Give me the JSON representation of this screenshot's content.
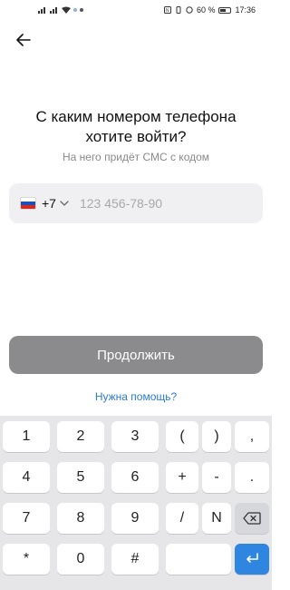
{
  "status_bar": {
    "battery_percent": "60 %",
    "time": "17:36"
  },
  "header": {
    "back_icon": "arrow-left-icon"
  },
  "main": {
    "title_line1": "С каким номером телефона",
    "title_line2": "хотите войти?",
    "subtitle": "На него придёт СМС с кодом",
    "phone": {
      "country_code": "+7",
      "placeholder": "123 456-78-90",
      "value": ""
    },
    "continue_label": "Продолжить",
    "help_label": "Нужна помощь?"
  },
  "keyboard": {
    "rows": [
      [
        "1",
        "2",
        "3",
        "(",
        ")",
        ","
      ],
      [
        "4",
        "5",
        "6",
        "+",
        "-",
        "."
      ],
      [
        "7",
        "8",
        "9",
        "/",
        "N",
        "backspace"
      ],
      [
        "*",
        "0",
        "#",
        "",
        "enter"
      ]
    ]
  },
  "colors": {
    "accent": "#2f86e0",
    "button_disabled": "#8b8b8d",
    "link": "#2a7bd6"
  }
}
